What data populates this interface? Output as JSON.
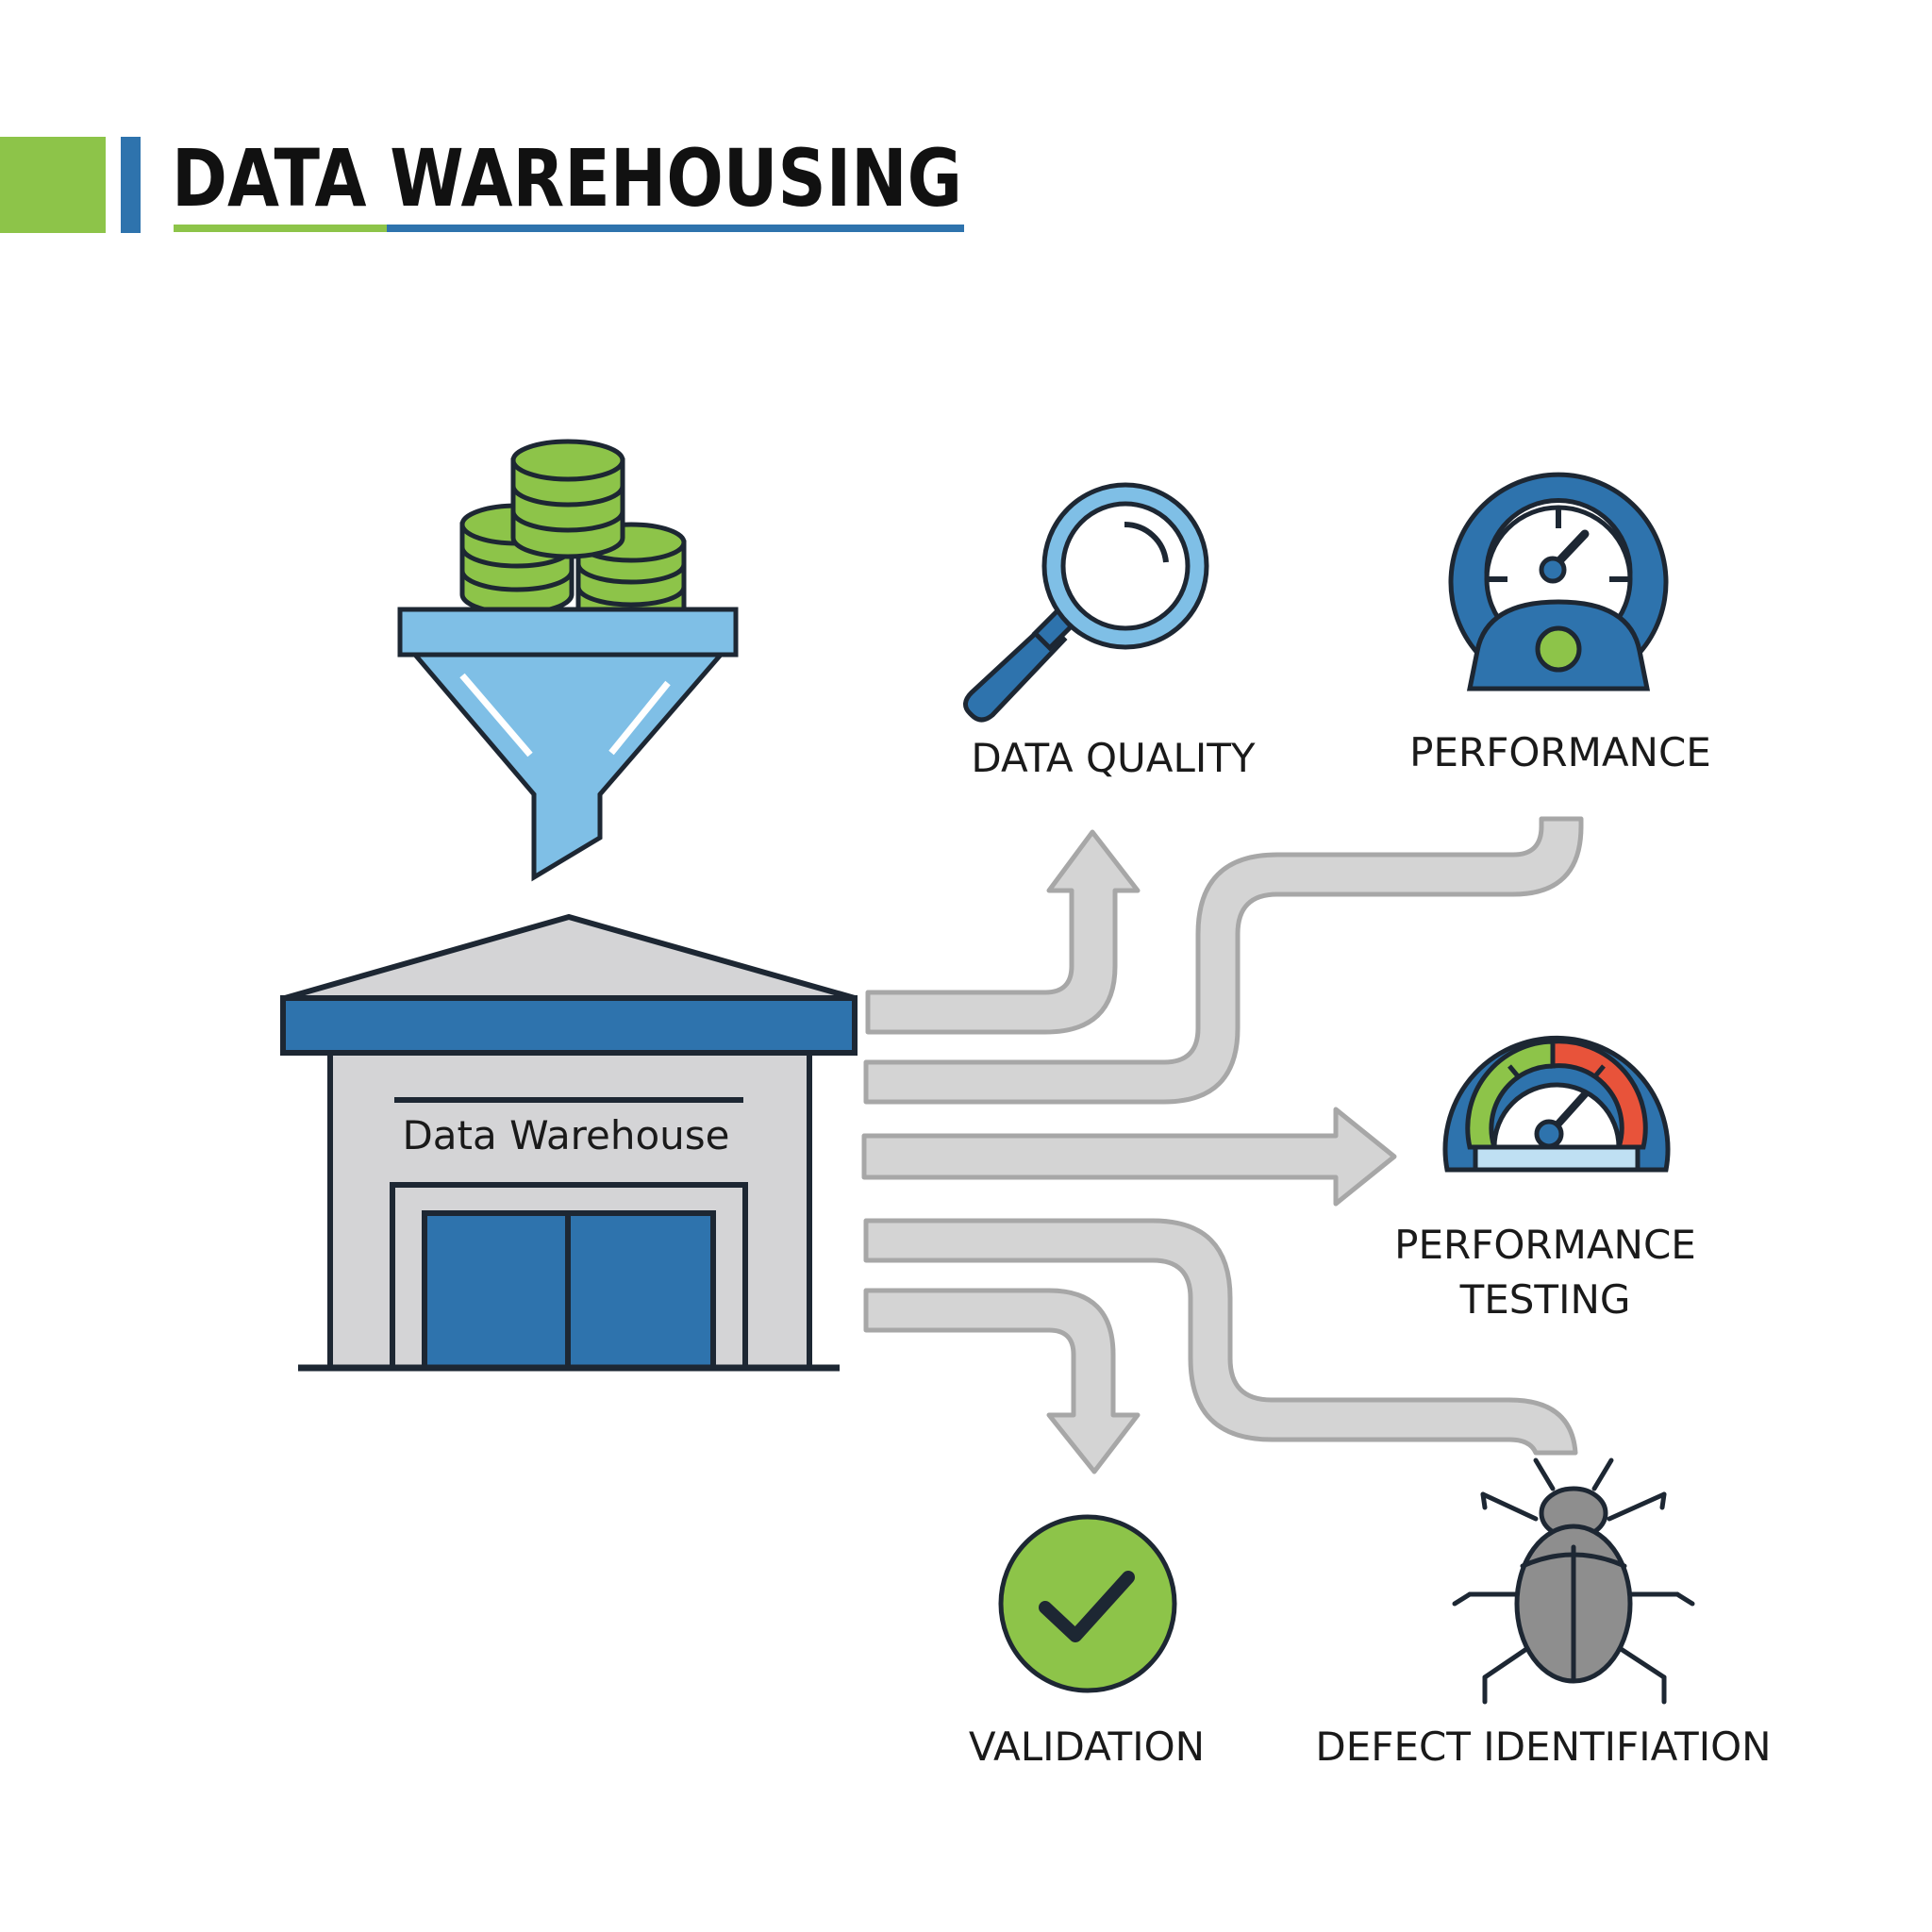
{
  "title": "DATA WAREHOUSING",
  "warehouse": {
    "label": "Data Warehouse"
  },
  "outcomes": {
    "data_quality": "DATA QUALITY",
    "performance": "PERFORMANCE",
    "performance_testing": [
      "PERFORMANCE",
      "TESTING"
    ],
    "validation": "VALIDATION",
    "defect_identification": "DEFECT IDENTIFIATION"
  },
  "colors": {
    "green": "#8dc449",
    "blue": "#2e73ad",
    "light_blue": "#7fbfe6",
    "gray_arrow": "#d4d4d4",
    "gray_outline": "#a7a7a7",
    "dark": "#1d2733",
    "red": "#e8533a"
  }
}
